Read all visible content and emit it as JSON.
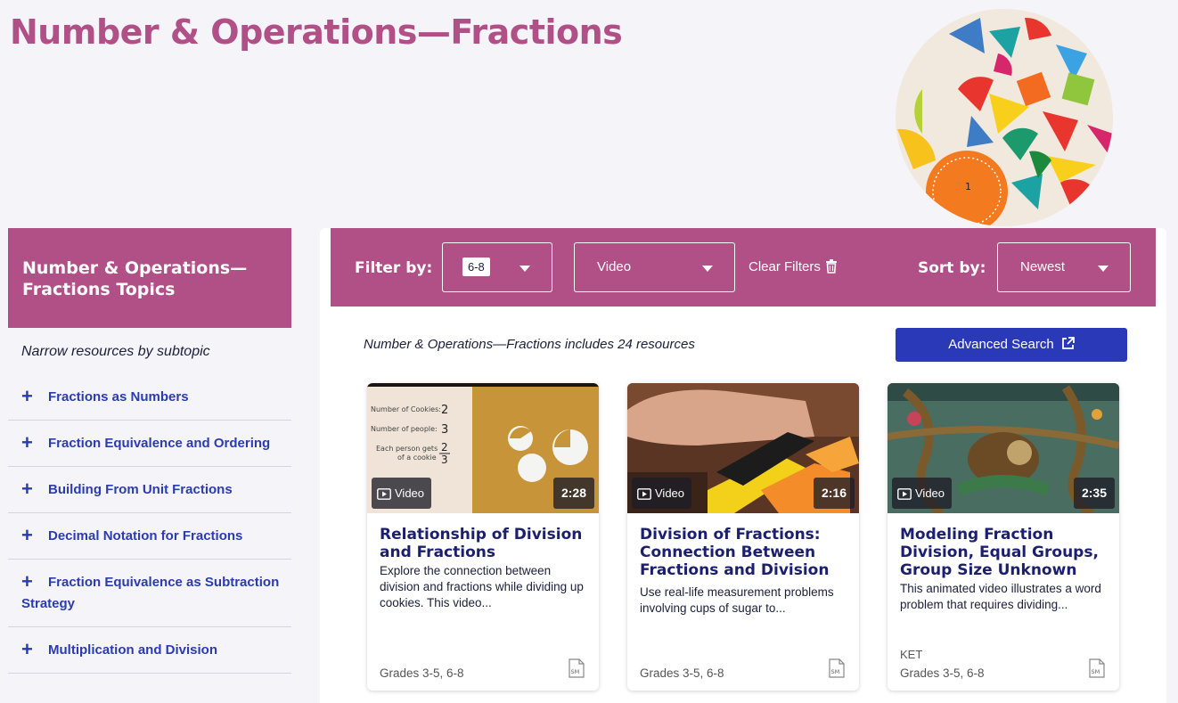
{
  "page": {
    "title": "Number & Operations—Fractions"
  },
  "sidebar": {
    "heading": "Number & Operations— Fractions Topics",
    "subtitle": "Narrow resources by subtopic",
    "items": [
      {
        "label": "Fractions as Numbers"
      },
      {
        "label": "Fraction Equivalence and Ordering"
      },
      {
        "label": "Building From Unit Fractions"
      },
      {
        "label": "Decimal Notation for Fractions"
      },
      {
        "label": "Fraction Equivalence as Subtraction Strategy"
      },
      {
        "label": "Multiplication and Division"
      }
    ]
  },
  "filters": {
    "filter_label": "Filter by:",
    "grade_value": "6-8",
    "type_value": "Video",
    "clear_label": "Clear Filters",
    "sort_label": "Sort by:",
    "sort_value": "Newest"
  },
  "results": {
    "count_text": "Number & Operations—Fractions includes 24 resources",
    "advanced_search": "Advanced Search"
  },
  "cards": [
    {
      "type": "Video",
      "duration": "2:28",
      "title": "Relationship of Division and Fractions",
      "description": "Explore the connection between division and fractions while dividing up cookies. This video...",
      "source": "",
      "grades": "Grades 3-5, 6-8",
      "thumb_text": {
        "l1": "Number of Cookies:",
        "v1": "2",
        "l2": "Number of people:",
        "v2": "3",
        "l3": "Each person gets",
        "l4": "of a cookie",
        "num": "2",
        "den": "3"
      }
    },
    {
      "type": "Video",
      "duration": "2:16",
      "title": "Division of Fractions: Connection Between Fractions and Division",
      "description": "Use real-life measurement problems involving cups of sugar to...",
      "source": "",
      "grades": "Grades 3-5, 6-8"
    },
    {
      "type": "Video",
      "duration": "2:35",
      "title": "Modeling Fraction Division, Equal Groups, Group Size Unknown",
      "description": "This animated video illustrates a word problem that requires dividing...",
      "source": "KET",
      "grades": "Grades 3-5, 6-8"
    }
  ],
  "icon_label": "SM",
  "colors": {
    "brand": "#b14f87",
    "button": "#2a39b8",
    "link": "#2b3bb0",
    "title_dark": "#1b1f6e"
  }
}
